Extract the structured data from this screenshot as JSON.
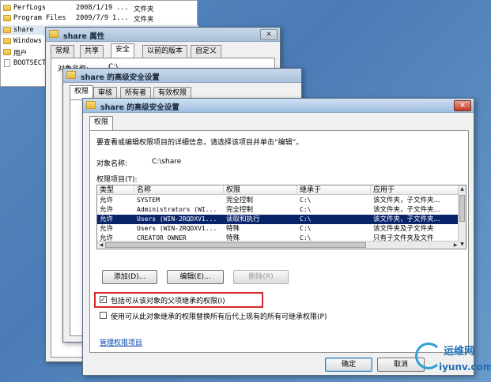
{
  "explorer": {
    "rows": [
      {
        "name": "PerfLogs",
        "date": "2008/1/19 ...",
        "type": "文件夹",
        "icon": "folder-icon"
      },
      {
        "name": "Program Files",
        "date": "2009/7/9 1...",
        "type": "文件夹",
        "icon": "folder-icon"
      },
      {
        "name": "share",
        "date": "",
        "type": "",
        "icon": "folder-icon"
      },
      {
        "name": "Windows",
        "date": "",
        "type": "",
        "icon": "folder-icon"
      },
      {
        "name": "用户",
        "date": "",
        "type": "",
        "icon": "folder-icon"
      },
      {
        "name": "BOOTSECT.",
        "date": "",
        "type": "",
        "icon": "file-icon"
      }
    ]
  },
  "props": {
    "title": "share 属性",
    "tabs": [
      "常规",
      "共享",
      "安全",
      "以前的版本",
      "自定义"
    ],
    "obj_label_partial": "对象名称:",
    "obj_value_partial": "C:\\"
  },
  "adv_bg": {
    "title": "share 的高级安全设置",
    "tabs": [
      "权限",
      "审核",
      "所有者",
      "有效权限"
    ]
  },
  "adv": {
    "title": "share 的高级安全设置",
    "tab": "权限",
    "instruction": "要查看或编辑权限项目的详细信息，请选择该项目并单击“编辑”。",
    "object_label": "对象名称:",
    "object_value": "C:\\share",
    "entries_label": "权限项目(T):",
    "columns": [
      "类型",
      "名称",
      "权限",
      "继承于",
      "应用于"
    ],
    "rows": [
      {
        "type": "允许",
        "name": "SYSTEM",
        "perm": "完全控制",
        "inherit": "C:\\",
        "apply": "该文件夹，子文件夹..."
      },
      {
        "type": "允许",
        "name": "Administrators (WI...",
        "perm": "完全控制",
        "inherit": "C:\\",
        "apply": "该文件夹，子文件夹..."
      },
      {
        "type": "允许",
        "name": "Users (WIN-2RQDXV1...",
        "perm": "读取和执行",
        "inherit": "C:\\",
        "apply": "该文件夹，子文件夹..."
      },
      {
        "type": "允许",
        "name": "Users (WIN-2RQDXV1...",
        "perm": "特殊",
        "inherit": "C:\\",
        "apply": "该文件夹及子文件夹"
      },
      {
        "type": "允许",
        "name": "CREATOR OWNER",
        "perm": "特殊",
        "inherit": "C:\\",
        "apply": "只有子文件夹及文件"
      }
    ],
    "selected_row": 2,
    "buttons": {
      "add": "添加(D)...",
      "edit": "编辑(E)...",
      "remove": "删除(R)"
    },
    "include_inheritable": {
      "label": "包括可从该对象的父项继承的权限(I)",
      "checked": true
    },
    "replace_children": {
      "label": "使用可从此对象继承的权限替换所有后代上现有的所有可继承权限(P)",
      "checked": false
    },
    "manage_link": "管理权限项目",
    "ok": "确定",
    "cancel": "取消"
  },
  "watermark": {
    "cn": "运维网",
    "url": "iyunv.com"
  },
  "colors": {
    "selection": "#0a246a",
    "highlight_box": "#d9242a",
    "link": "#0645ad"
  }
}
